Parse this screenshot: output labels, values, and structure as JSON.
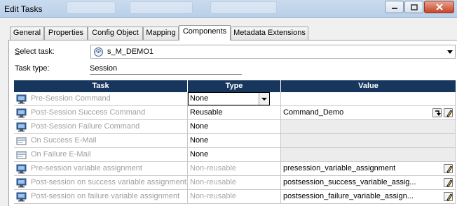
{
  "window": {
    "title": "Edit Tasks",
    "buttons": [
      "minimize",
      "maximize",
      "close"
    ]
  },
  "tabs": [
    {
      "label": "General",
      "active": false
    },
    {
      "label": "Properties",
      "active": false
    },
    {
      "label": "Config Object",
      "active": false
    },
    {
      "label": "Mapping",
      "active": false
    },
    {
      "label": "Components",
      "active": true
    },
    {
      "label": "Metadata Extensions",
      "active": false
    }
  ],
  "form": {
    "select_task_label": "Select task:",
    "select_task_value": "s_M_DEMO1",
    "task_type_label": "Task type:",
    "task_type_value": "Session"
  },
  "grid": {
    "columns": [
      "Task",
      "Type",
      "Value"
    ],
    "rows": [
      {
        "task": "Pre-Session Command",
        "type": "None",
        "value": "",
        "type_dropdown": true,
        "value_gray": false,
        "icon": "command-icon"
      },
      {
        "task": "Post-Session Success Command",
        "type": "Reusable",
        "value": "Command_Demo",
        "value_gray": false,
        "icon": "command-icon",
        "buttons": [
          "goto-icon",
          "edit-icon"
        ]
      },
      {
        "task": "Post-Session Failure Command",
        "type": "None",
        "value": "",
        "value_gray": true,
        "icon": "command-icon"
      },
      {
        "task": "On Success E-Mail",
        "type": "None",
        "value": "",
        "value_gray": true,
        "icon": "email-icon"
      },
      {
        "task": "On Failure E-Mail",
        "type": "None",
        "value": "",
        "value_gray": true,
        "icon": "email-icon"
      },
      {
        "task": "Pre-session variable assignment",
        "type": "Non-reusable",
        "type_dim": true,
        "value": "presession_variable_assignment",
        "value_gray": false,
        "icon": "command-icon",
        "buttons": [
          "edit-icon"
        ]
      },
      {
        "task": "Post-session on success variable assignment",
        "type": "Non-reusable",
        "type_dim": true,
        "value": "postsession_success_variable_assig...",
        "value_gray": false,
        "icon": "command-icon",
        "buttons": [
          "edit-icon"
        ]
      },
      {
        "task": "Post-session on failure variable assignment",
        "type": "Non-reusable",
        "type_dim": true,
        "value": "postsession_failure_variable_assign...",
        "value_gray": false,
        "icon": "command-icon",
        "buttons": [
          "edit-icon"
        ]
      }
    ]
  }
}
